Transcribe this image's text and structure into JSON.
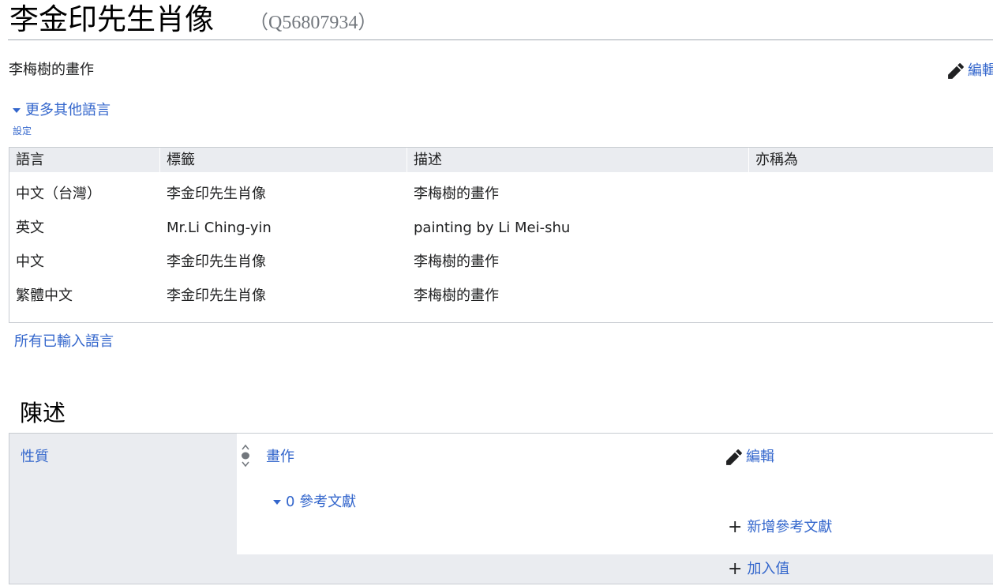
{
  "header": {
    "title": "李金印先生肖像",
    "qid": "（Q56807934）"
  },
  "description": "李梅樹的畫作",
  "edit_label": "編輯",
  "more_languages_label": "更多其他語言",
  "settings_label": "設定",
  "language_table": {
    "columns": [
      "語言",
      "標籤",
      "描述",
      "亦稱為"
    ],
    "rows": [
      {
        "language": "中文（台灣）",
        "label": "李金印先生肖像",
        "description": "李梅樹的畫作",
        "aliases": ""
      },
      {
        "language": "英文",
        "label": "Mr.Li Ching-yin",
        "description": "painting by Li Mei-shu",
        "aliases": ""
      },
      {
        "language": "中文",
        "label": "李金印先生肖像",
        "description": "李梅樹的畫作",
        "aliases": ""
      },
      {
        "language": "繁體中文",
        "label": "李金印先生肖像",
        "description": "李梅樹的畫作",
        "aliases": ""
      }
    ]
  },
  "all_languages_label": "所有已輸入語言",
  "statements": {
    "heading": "陳述",
    "groups": [
      {
        "property": "性質",
        "value": "畫作",
        "edit_label": "編輯",
        "references_label": "0 參考文獻",
        "add_reference_label": "新增參考文獻",
        "add_value_label": "加入值"
      }
    ]
  },
  "colors": {
    "link": "#3366cc",
    "table_header_bg": "#eaecf0",
    "border": "#c8ccd1"
  },
  "icons": {
    "edit": "pencil-icon",
    "expand": "caret-down-icon",
    "rank": "normal-rank-icon",
    "add": "plus-icon"
  }
}
